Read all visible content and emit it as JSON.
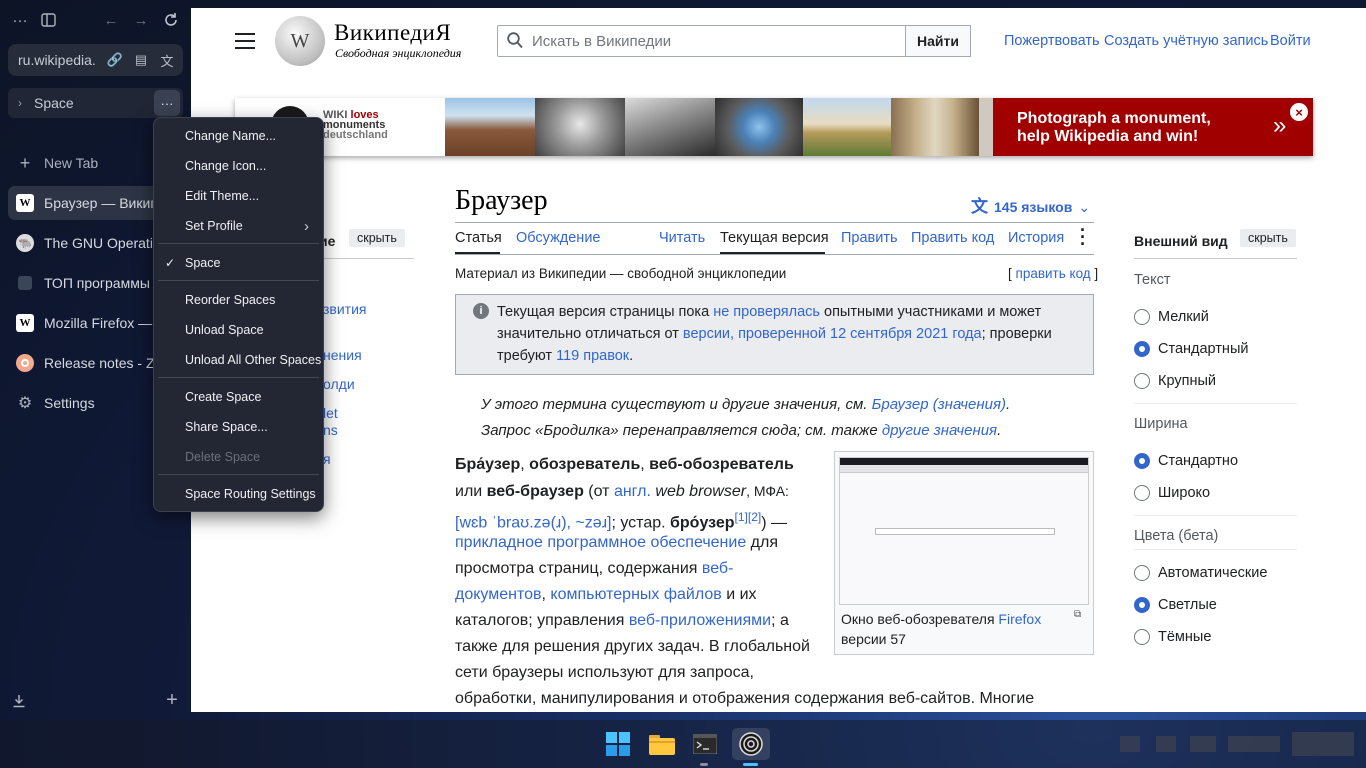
{
  "sidebar": {
    "url": "ru.wikipedia.",
    "space_name": "Space",
    "new_tab": "New Tab",
    "tabs": [
      {
        "title": "Браузер — Википедия",
        "icon": "wikipedia-icon"
      },
      {
        "title": "The GNU Operating System",
        "icon": "gnu-icon"
      },
      {
        "title": "ТОП программы",
        "icon": "page-icon"
      },
      {
        "title": "Mozilla Firefox — Википедия",
        "icon": "wikipedia-icon"
      },
      {
        "title": "Release notes - Zen Browser",
        "icon": "zen-icon"
      }
    ],
    "settings": "Settings"
  },
  "context_menu": {
    "items": [
      "Change Name...",
      "Change Icon...",
      "Edit Theme...",
      "Set Profile",
      "Space",
      "Reorder Spaces",
      "Unload Space",
      "Unload All Other Spaces",
      "Create Space",
      "Share Space...",
      "Delete Space",
      "Space Routing Settings"
    ]
  },
  "wiki": {
    "logo_title": "ВикипедиЯ",
    "logo_subtitle": "Свободная энциклопедия",
    "search_placeholder": "Искать в Википедии",
    "search_button": "Найти",
    "donate": "Пожертвовать",
    "create_account": "Создать учётную запись",
    "login": "Войти",
    "banner_logo_wiki": "WIKI",
    "banner_logo_loves": "loves",
    "banner_logo_monuments": "monuments",
    "banner_logo_country": "deutschland",
    "banner_line1": "Photograph a monument,",
    "banner_line2": "help Wikipedia and win!",
    "banner_chevron": "»",
    "article_title": "Браузер",
    "languages": "145 языков",
    "tab_article": "Статья",
    "tab_discussion": "Обсуждение",
    "tab_read": "Читать",
    "tab_current": "Текущая версия",
    "tab_edit": "Править",
    "tab_edit_code": "Править код",
    "tab_history": "История",
    "sub": "Материал из Википедии — свободной энциклопедии",
    "edit_code_link": "править код",
    "notice_a": "Текущая версия страницы пока ",
    "notice_link1": "не проверялась",
    "notice_b": " опытными участниками и может",
    "notice_c": "значительно отличаться от ",
    "notice_link2": "версии, проверенной 12 сентября 2021 года",
    "notice_d": "; проверки",
    "notice_e": "требуют ",
    "notice_link3": "119 правок",
    "notice_f": ".",
    "hat1_a": "У этого термина существуют и другие значения, см. ",
    "hat1_link": "Браузер (значения)",
    "hat1_b": ".",
    "hat2_a": "Запрос «Бродилка» перенаправляется сюда; см. также ",
    "hat2_link": "другие значения",
    "hat2_b": ".",
    "fig_caption_a": "Окно веб-обозревателя ",
    "fig_caption_link": "Firefox",
    "fig_caption_b": "версии 57",
    "left_heading": "ие",
    "left_hide": "скрыть",
    "left_links": [
      "звития",
      "нения",
      "олди",
      "let",
      "ns",
      "я"
    ],
    "appearance": "Внешний вид",
    "appearance_hide": "скрыть",
    "text_label": "Текст",
    "text_options": [
      "Мелкий",
      "Стандартный",
      "Крупный"
    ],
    "width_label": "Ширина",
    "width_options": [
      "Стандартно",
      "Широко"
    ],
    "colors_label": "Цвета (бета)",
    "color_options": [
      "Автоматические",
      "Светлые",
      "Тёмные"
    ]
  },
  "body": {
    "l1_b1": "Бра́узер",
    "l1_t1": ", ",
    "l1_b2": "обозреватель",
    "l1_t2": ", ",
    "l1_b3": "веб-обозреватель",
    "l2_t1": "или ",
    "l2_b1": "веб-браузер",
    "l2_t2": " (от ",
    "l2_link": "англ.",
    "l2_i": " web browser",
    "l2_t3": ", МФА:",
    "l3_link": "[wɛb ˈbraʊ.zə(ɹ), ~zəɹ]",
    "l3_t1": "; устар. ",
    "l3_b1": "бро́узер",
    "l3_sup": "[1][2]",
    "l3_t2": ") —",
    "l4_link": "прикладное программное обеспечение",
    "l4_t1": " для",
    "l5_t1": "просмотра страниц, содержания ",
    "l5_link": "веб-",
    "l6_link1": "документов",
    "l6_t1": ", ",
    "l6_link2": "компьютерных файлов",
    "l6_t2": " и их",
    "l7_t1": "каталогов; управления ",
    "l7_link": "веб-приложениями",
    "l7_t2": "; а",
    "l8": "также для решения других задач. В глобальной",
    "l9": "сети браузеры используют для запроса,",
    "l10": "обработки, манипулирования и отображения содержания веб-сайтов. Многие"
  },
  "colors": {
    "link": "#3366cc",
    "banner_red": "#a10000",
    "accent": "#3366cc"
  }
}
